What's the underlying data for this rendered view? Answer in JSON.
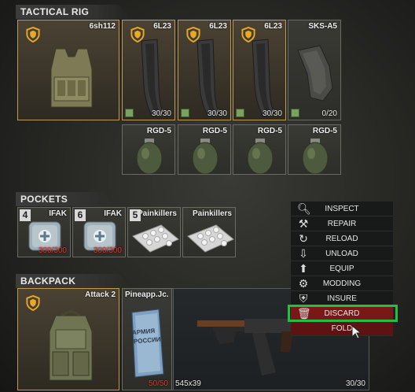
{
  "sections": {
    "rig": "TACTICAL RIG",
    "pockets": "POCKETS",
    "backpack": "BACKPACK"
  },
  "rig": {
    "vest": {
      "name": "6sh112",
      "icon": "armor-vest-icon"
    },
    "magazines": [
      {
        "name": "6L23",
        "count": "30/30",
        "icon": "ak-magazine-icon"
      },
      {
        "name": "6L23",
        "count": "30/30",
        "icon": "ak-magazine-icon"
      },
      {
        "name": "6L23",
        "count": "30/30",
        "icon": "ak-magazine-icon"
      },
      {
        "name": "SKS-A5",
        "count": "0/20",
        "icon": "sks-magazine-icon"
      }
    ],
    "grenades": [
      {
        "name": "RGD-5",
        "icon": "grenade-icon"
      },
      {
        "name": "RGD-5",
        "icon": "grenade-icon"
      },
      {
        "name": "RGD-5",
        "icon": "grenade-icon"
      },
      {
        "name": "RGD-5",
        "icon": "grenade-icon"
      }
    ]
  },
  "pockets": [
    {
      "badge": "4",
      "name": "IFAK",
      "count": "300/300",
      "icon": "medkit-icon"
    },
    {
      "badge": "6",
      "name": "IFAK",
      "count": "300/300",
      "icon": "medkit-icon"
    },
    {
      "badge": "5",
      "name": "Painkillers",
      "icon": "pills-icon"
    },
    {
      "name": "Painkillers",
      "icon": "pills-icon"
    }
  ],
  "backpack": {
    "bag": {
      "name": "Attack 2",
      "icon": "backpack-icon"
    },
    "juice": {
      "name": "Pineapp.Jc.",
      "count": "50/50",
      "label_top": "АРМИЯ",
      "label_bottom": "РОССИИ",
      "icon": "juice-box-icon"
    },
    "weapon": {
      "caliber": "545x39",
      "count": "30/30",
      "icon": "rifle-icon"
    }
  },
  "menu": [
    {
      "label": "INSPECT",
      "icon": "magnifier-icon"
    },
    {
      "label": "REPAIR",
      "icon": "wrench-icon"
    },
    {
      "label": "RELOAD",
      "icon": "reload-icon"
    },
    {
      "label": "UNLOAD",
      "icon": "unload-icon"
    },
    {
      "label": "EQUIP",
      "icon": "equip-icon"
    },
    {
      "label": "MODDING",
      "icon": "modding-icon"
    },
    {
      "label": "INSURE",
      "icon": "insure-icon"
    },
    {
      "label": "DISCARD",
      "icon": "discard-icon"
    },
    {
      "label": "FOLD",
      "icon": "fold-icon"
    }
  ],
  "colors": {
    "highlight": "#22c040",
    "discard": "#7a1818",
    "count_red": "#e03a2a",
    "rig_border": "#c19a52"
  }
}
